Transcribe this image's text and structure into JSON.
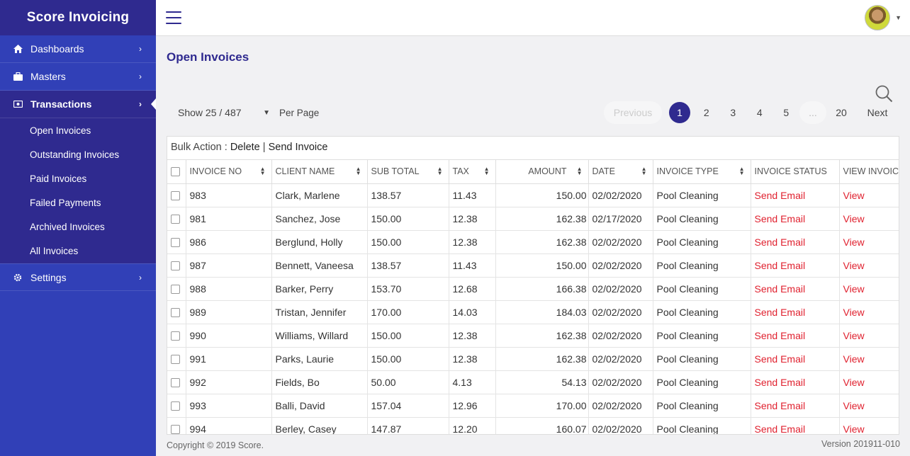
{
  "app": {
    "title": "Score Invoicing"
  },
  "sidebar": {
    "items": [
      {
        "label": "Dashboards",
        "icon": "home-icon"
      },
      {
        "label": "Masters",
        "icon": "briefcase-icon"
      },
      {
        "label": "Transactions",
        "icon": "money-icon",
        "active": true
      },
      {
        "label": "Settings",
        "icon": "gear-icon"
      }
    ],
    "submenu": [
      "Open Invoices",
      "Outstanding Invoices",
      "Paid Invoices",
      "Failed Payments",
      "Archived Invoices",
      "All Invoices"
    ]
  },
  "header": {
    "avatar": "user-avatar"
  },
  "page": {
    "title": "Open Invoices",
    "per_page_value": "Show 25 / 487",
    "per_page_label": "Per Page",
    "bulk_label": "Bulk Action :",
    "bulk_delete": "Delete",
    "bulk_sep": "|",
    "bulk_send": "Send Invoice"
  },
  "pager": {
    "prev": "Previous",
    "pages": [
      "1",
      "2",
      "3",
      "4",
      "5"
    ],
    "current": "1",
    "ellipsis": "...",
    "last": "20",
    "next": "Next"
  },
  "table": {
    "columns": [
      "INVOICE NO",
      "CLIENT NAME",
      "SUB TOTAL",
      "TAX",
      "AMOUNT",
      "DATE",
      "INVOICE TYPE",
      "INVOICE STATUS",
      "VIEW INVOICE"
    ],
    "rows": [
      [
        "983",
        "Clark, Marlene",
        "138.57",
        "11.43",
        "150.00",
        "02/02/2020",
        "Pool Cleaning",
        "Send Email",
        "View"
      ],
      [
        "981",
        "Sanchez, Jose",
        "150.00",
        "12.38",
        "162.38",
        "02/17/2020",
        "Pool Cleaning",
        "Send Email",
        "View"
      ],
      [
        "986",
        "Berglund, Holly",
        "150.00",
        "12.38",
        "162.38",
        "02/02/2020",
        "Pool Cleaning",
        "Send Email",
        "View"
      ],
      [
        "987",
        "Bennett, Vaneesa",
        "138.57",
        "11.43",
        "150.00",
        "02/02/2020",
        "Pool Cleaning",
        "Send Email",
        "View"
      ],
      [
        "988",
        "Barker, Perry",
        "153.70",
        "12.68",
        "166.38",
        "02/02/2020",
        "Pool Cleaning",
        "Send Email",
        "View"
      ],
      [
        "989",
        "Tristan, Jennifer",
        "170.00",
        "14.03",
        "184.03",
        "02/02/2020",
        "Pool Cleaning",
        "Send Email",
        "View"
      ],
      [
        "990",
        "Williams, Willard",
        "150.00",
        "12.38",
        "162.38",
        "02/02/2020",
        "Pool Cleaning",
        "Send Email",
        "View"
      ],
      [
        "991",
        "Parks, Laurie",
        "150.00",
        "12.38",
        "162.38",
        "02/02/2020",
        "Pool Cleaning",
        "Send Email",
        "View"
      ],
      [
        "992",
        "Fields, Bo",
        "50.00",
        "4.13",
        "54.13",
        "02/02/2020",
        "Pool Cleaning",
        "Send Email",
        "View"
      ],
      [
        "993",
        "Balli, David",
        "157.04",
        "12.96",
        "170.00",
        "02/02/2020",
        "Pool Cleaning",
        "Send Email",
        "View"
      ],
      [
        "994",
        "Berley, Casey",
        "147.87",
        "12.20",
        "160.07",
        "02/02/2020",
        "Pool Cleaning",
        "Send Email",
        "View"
      ]
    ]
  },
  "footer": {
    "copyright": "Copyright © 2019 Score.",
    "version": "Version 201911-010"
  },
  "colors": {
    "sidebar": "#3140b7",
    "sidebar_dark": "#2f2a8f",
    "link_red": "#e0212f"
  }
}
